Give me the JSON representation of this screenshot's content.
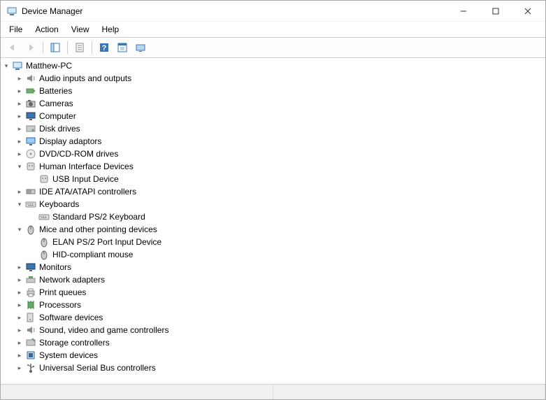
{
  "window": {
    "title": "Device Manager"
  },
  "menu": {
    "file": "File",
    "action": "Action",
    "view": "View",
    "help": "Help"
  },
  "tree": {
    "root": {
      "label": "Matthew-PC",
      "expanded": true,
      "icon": "computer",
      "children": [
        {
          "label": "Audio inputs and outputs",
          "icon": "audio",
          "expanded": false,
          "hasChildren": true
        },
        {
          "label": "Batteries",
          "icon": "battery",
          "expanded": false,
          "hasChildren": true
        },
        {
          "label": "Cameras",
          "icon": "camera",
          "expanded": false,
          "hasChildren": true
        },
        {
          "label": "Computer",
          "icon": "monitor",
          "expanded": false,
          "hasChildren": true
        },
        {
          "label": "Disk drives",
          "icon": "disk",
          "expanded": false,
          "hasChildren": true
        },
        {
          "label": "Display adaptors",
          "icon": "display",
          "expanded": false,
          "hasChildren": true
        },
        {
          "label": "DVD/CD-ROM drives",
          "icon": "dvd",
          "expanded": false,
          "hasChildren": true
        },
        {
          "label": "Human Interface Devices",
          "icon": "hid",
          "expanded": true,
          "hasChildren": true,
          "children": [
            {
              "label": "USB Input Device",
              "icon": "hid",
              "hasChildren": false
            }
          ]
        },
        {
          "label": "IDE ATA/ATAPI controllers",
          "icon": "ide",
          "expanded": false,
          "hasChildren": true
        },
        {
          "label": "Keyboards",
          "icon": "keyboard",
          "expanded": true,
          "hasChildren": true,
          "children": [
            {
              "label": "Standard PS/2 Keyboard",
              "icon": "keyboard",
              "hasChildren": false
            }
          ]
        },
        {
          "label": "Mice and other pointing devices",
          "icon": "mouse",
          "expanded": true,
          "hasChildren": true,
          "children": [
            {
              "label": "ELAN PS/2 Port Input Device",
              "icon": "mouse",
              "hasChildren": false
            },
            {
              "label": "HID-compliant mouse",
              "icon": "mouse",
              "hasChildren": false
            }
          ]
        },
        {
          "label": "Monitors",
          "icon": "monitor",
          "expanded": false,
          "hasChildren": true
        },
        {
          "label": "Network adapters",
          "icon": "network",
          "expanded": false,
          "hasChildren": true
        },
        {
          "label": "Print queues",
          "icon": "printer",
          "expanded": false,
          "hasChildren": true
        },
        {
          "label": "Processors",
          "icon": "cpu",
          "expanded": false,
          "hasChildren": true
        },
        {
          "label": "Software devices",
          "icon": "software",
          "expanded": false,
          "hasChildren": true
        },
        {
          "label": "Sound, video and game controllers",
          "icon": "audio",
          "expanded": false,
          "hasChildren": true
        },
        {
          "label": "Storage controllers",
          "icon": "storage",
          "expanded": false,
          "hasChildren": true
        },
        {
          "label": "System devices",
          "icon": "system",
          "expanded": false,
          "hasChildren": true
        },
        {
          "label": "Universal Serial Bus controllers",
          "icon": "usb",
          "expanded": false,
          "hasChildren": true
        }
      ]
    }
  }
}
